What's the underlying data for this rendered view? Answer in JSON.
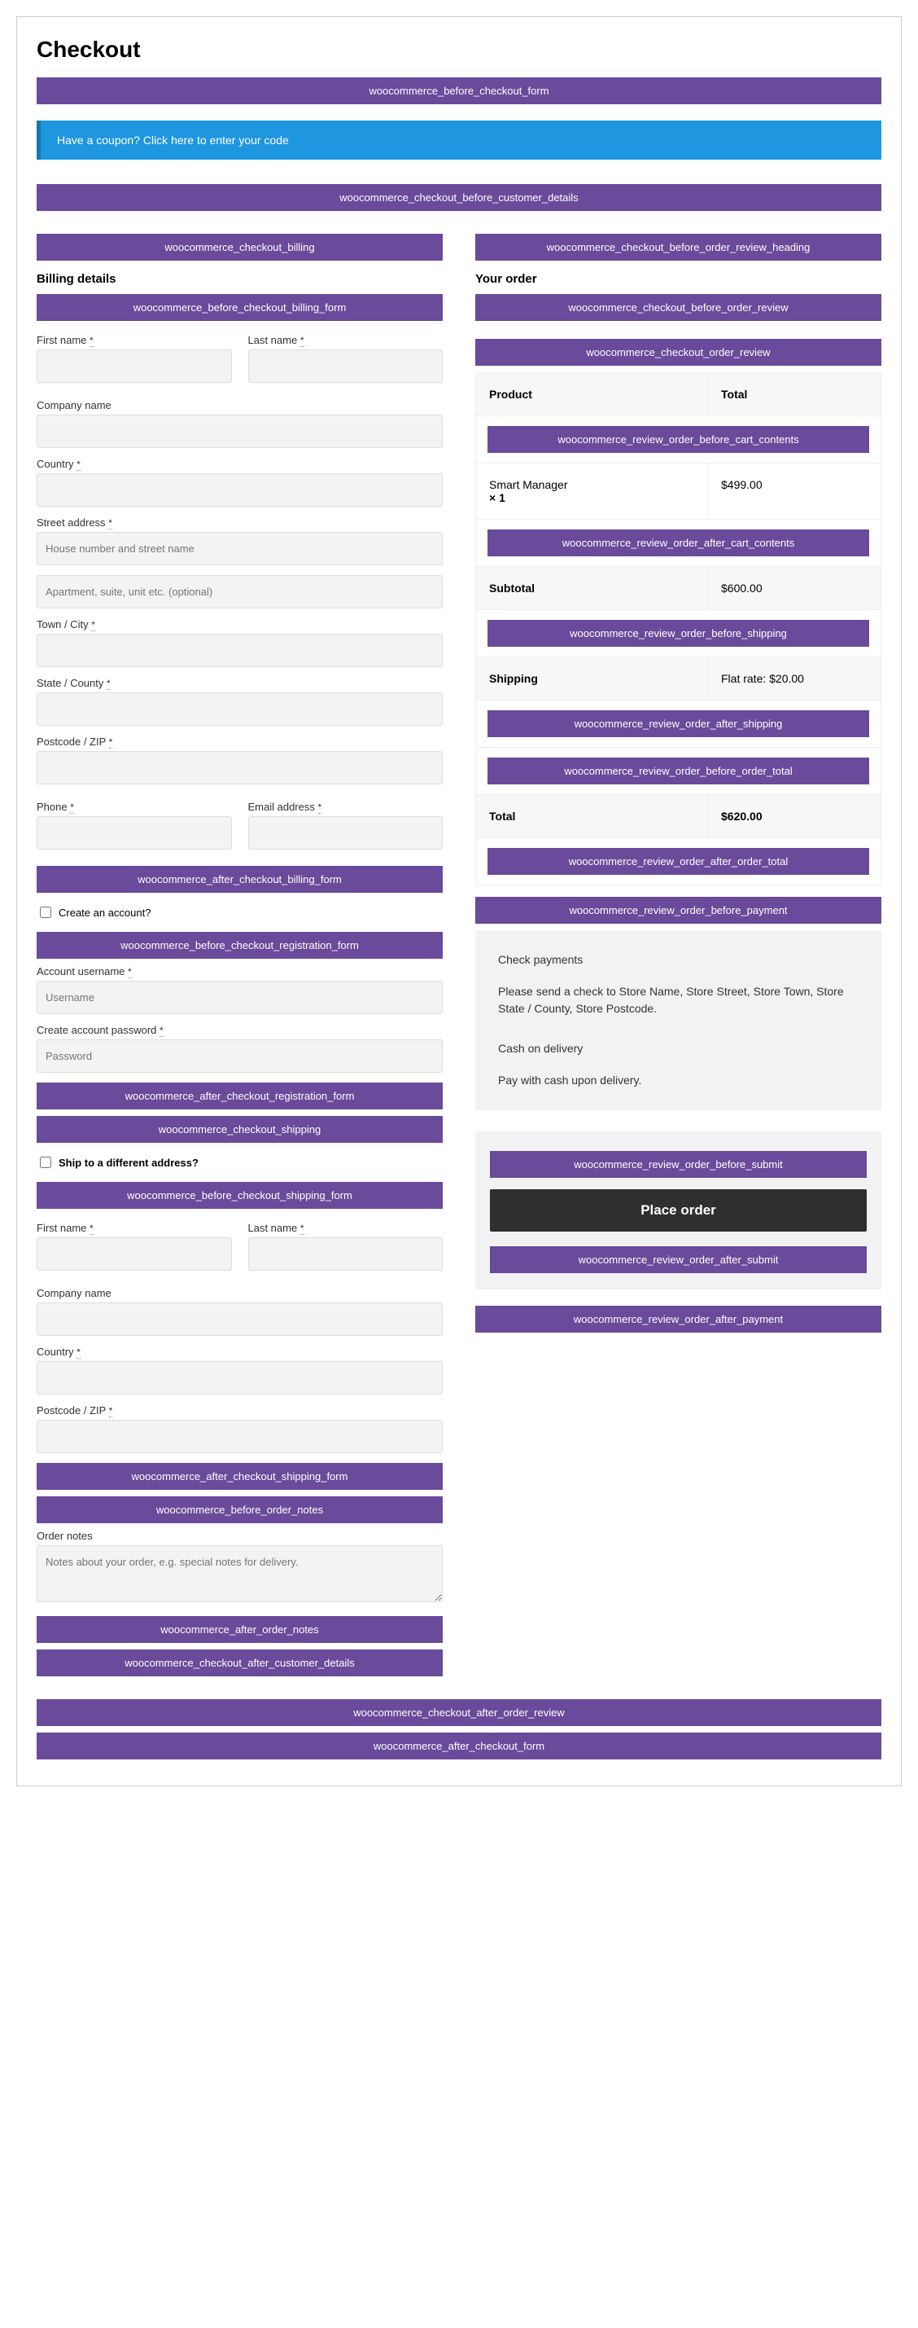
{
  "title": "Checkout",
  "hooks": {
    "before_checkout_form": "woocommerce_before_checkout_form",
    "before_customer_details": "woocommerce_checkout_before_customer_details",
    "checkout_billing": "woocommerce_checkout_billing",
    "before_billing_form": "woocommerce_before_checkout_billing_form",
    "after_billing_form": "woocommerce_after_checkout_billing_form",
    "before_registration_form": "woocommerce_before_checkout_registration_form",
    "after_registration_form": "woocommerce_after_checkout_registration_form",
    "checkout_shipping": "woocommerce_checkout_shipping",
    "before_shipping_form": "woocommerce_before_checkout_shipping_form",
    "after_shipping_form": "woocommerce_after_checkout_shipping_form",
    "before_order_notes": "woocommerce_before_order_notes",
    "after_order_notes": "woocommerce_after_order_notes",
    "after_customer_details": "woocommerce_checkout_after_customer_details",
    "before_order_review_heading": "woocommerce_checkout_before_order_review_heading",
    "before_order_review": "woocommerce_checkout_before_order_review",
    "order_review": "woocommerce_checkout_order_review",
    "before_cart_contents": "woocommerce_review_order_before_cart_contents",
    "after_cart_contents": "woocommerce_review_order_after_cart_contents",
    "before_shipping_review": "woocommerce_review_order_before_shipping",
    "after_shipping_review": "woocommerce_review_order_after_shipping",
    "before_order_total": "woocommerce_review_order_before_order_total",
    "after_order_total": "woocommerce_review_order_after_order_total",
    "before_payment": "woocommerce_review_order_before_payment",
    "before_submit": "woocommerce_review_order_before_submit",
    "after_submit": "woocommerce_review_order_after_submit",
    "after_payment": "woocommerce_review_order_after_payment",
    "after_order_review": "woocommerce_checkout_after_order_review",
    "after_checkout_form": "woocommerce_after_checkout_form"
  },
  "coupon_notice": "Have a coupon? Click here to enter your code",
  "billing": {
    "heading": "Billing details",
    "labels": {
      "first_name": "First name",
      "last_name": "Last name",
      "company": "Company name",
      "country": "Country",
      "street": "Street address",
      "street_ph1": "House number and street name",
      "street_ph2": "Apartment, suite, unit etc. (optional)",
      "town": "Town / City",
      "state": "State / County",
      "postcode": "Postcode / ZIP",
      "phone": "Phone",
      "email": "Email address"
    }
  },
  "account": {
    "create_label": "Create an account?",
    "username_label": "Account username",
    "username_ph": "Username",
    "password_label": "Create account password",
    "password_ph": "Password"
  },
  "shipping": {
    "ship_different": "Ship to a different address?",
    "labels": {
      "first_name": "First name",
      "last_name": "Last name",
      "company": "Company name",
      "country": "Country",
      "postcode": "Postcode / ZIP"
    }
  },
  "notes": {
    "label": "Order notes",
    "placeholder": "Notes about your order, e.g. special notes for delivery."
  },
  "order": {
    "heading": "Your order",
    "col_product": "Product",
    "col_total": "Total",
    "item_name": "Smart Manager",
    "item_qty": "× 1",
    "item_total": "$499.00",
    "subtotal_label": "Subtotal",
    "subtotal_val": "$600.00",
    "shipping_label": "Shipping",
    "shipping_val": "Flat rate: $20.00",
    "total_label": "Total",
    "total_val": "$620.00"
  },
  "payment": {
    "check_title": "Check payments",
    "check_desc": "Please send a check to Store Name, Store Street, Store Town, Store State / County, Store Postcode.",
    "cod_title": "Cash on delivery",
    "cod_desc": "Pay with cash upon delivery."
  },
  "submit": {
    "button": "Place order"
  },
  "required_mark": "*"
}
